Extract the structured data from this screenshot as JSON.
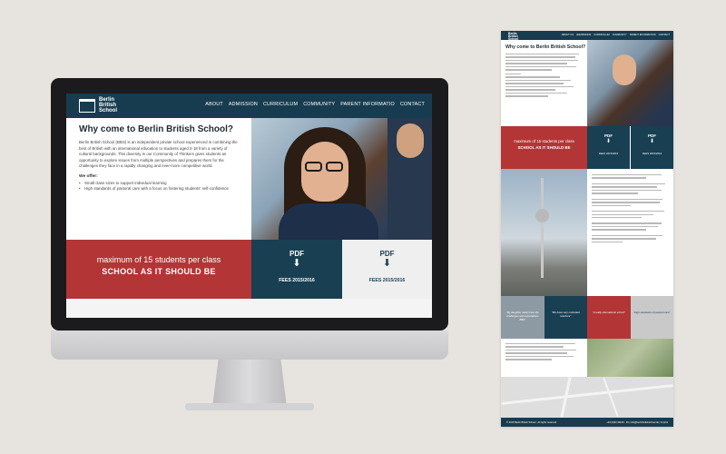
{
  "site": {
    "logo_lines": [
      "Berlin",
      "British",
      "School"
    ],
    "nav": [
      "ABOUT",
      "ADMISSION",
      "CURRICULUM",
      "COMMUNITY",
      "PARENT INFORMATIO",
      "CONTACT"
    ],
    "heading": "Why come to Berlin British School?",
    "intro": "Berlin British School (BBS) is an independent private school experienced in combining the best of British with an international education to students aged 2-18 from a variety of cultural backgrounds. This diversity in our Community of Thinkers gives students an opportunity to explore issues from multiple perspectives and prepares them for the challenges they face in a rapidly changing and ever-more competitive world.",
    "offer_title": "We offer:",
    "offer_items": [
      "Small class sizes to support individual learning",
      "High standards of pastoral care with a focus on fostering students' self-confidence"
    ],
    "banner_line1": "maximum of 15 students per class",
    "banner_line2": "SCHOOL AS IT SHOULD BE",
    "pdf_label": "PDF",
    "pdf_arrow": "⬇",
    "fees_label": "FEES 2015/2016"
  },
  "long_page": {
    "nav": [
      "ABOUT US",
      "ADMISSIONS",
      "CURRICULUM",
      "COMMUNITY",
      "PARENT INFORMATION",
      "CONTACT"
    ],
    "heading": "Why come to Berlin British School?",
    "banner_line1": "maximum of 15 students per class",
    "banner_line2": "SCHOOL AS IT SHOULD BE",
    "pdf_label": "PDF",
    "fees_label": "FEES 2015/2016",
    "tiles": [
      "\"My daughter really loves the challenges and expectations BBS\"",
      "\"We have very motivated teachers\"",
      "\"A really international school\"",
      "\"High standards of pastoral care\""
    ],
    "footer_left": "© 2016 Berlin British School - All rights reserved",
    "footer_right": "+49 (0)30 30109 - 36 | info@berlinbritishschool.de | Imprint"
  },
  "colors": {
    "navy": "#183c4f",
    "red": "#b33535",
    "light_panel": "#efefef",
    "background": "#e7e4df"
  }
}
